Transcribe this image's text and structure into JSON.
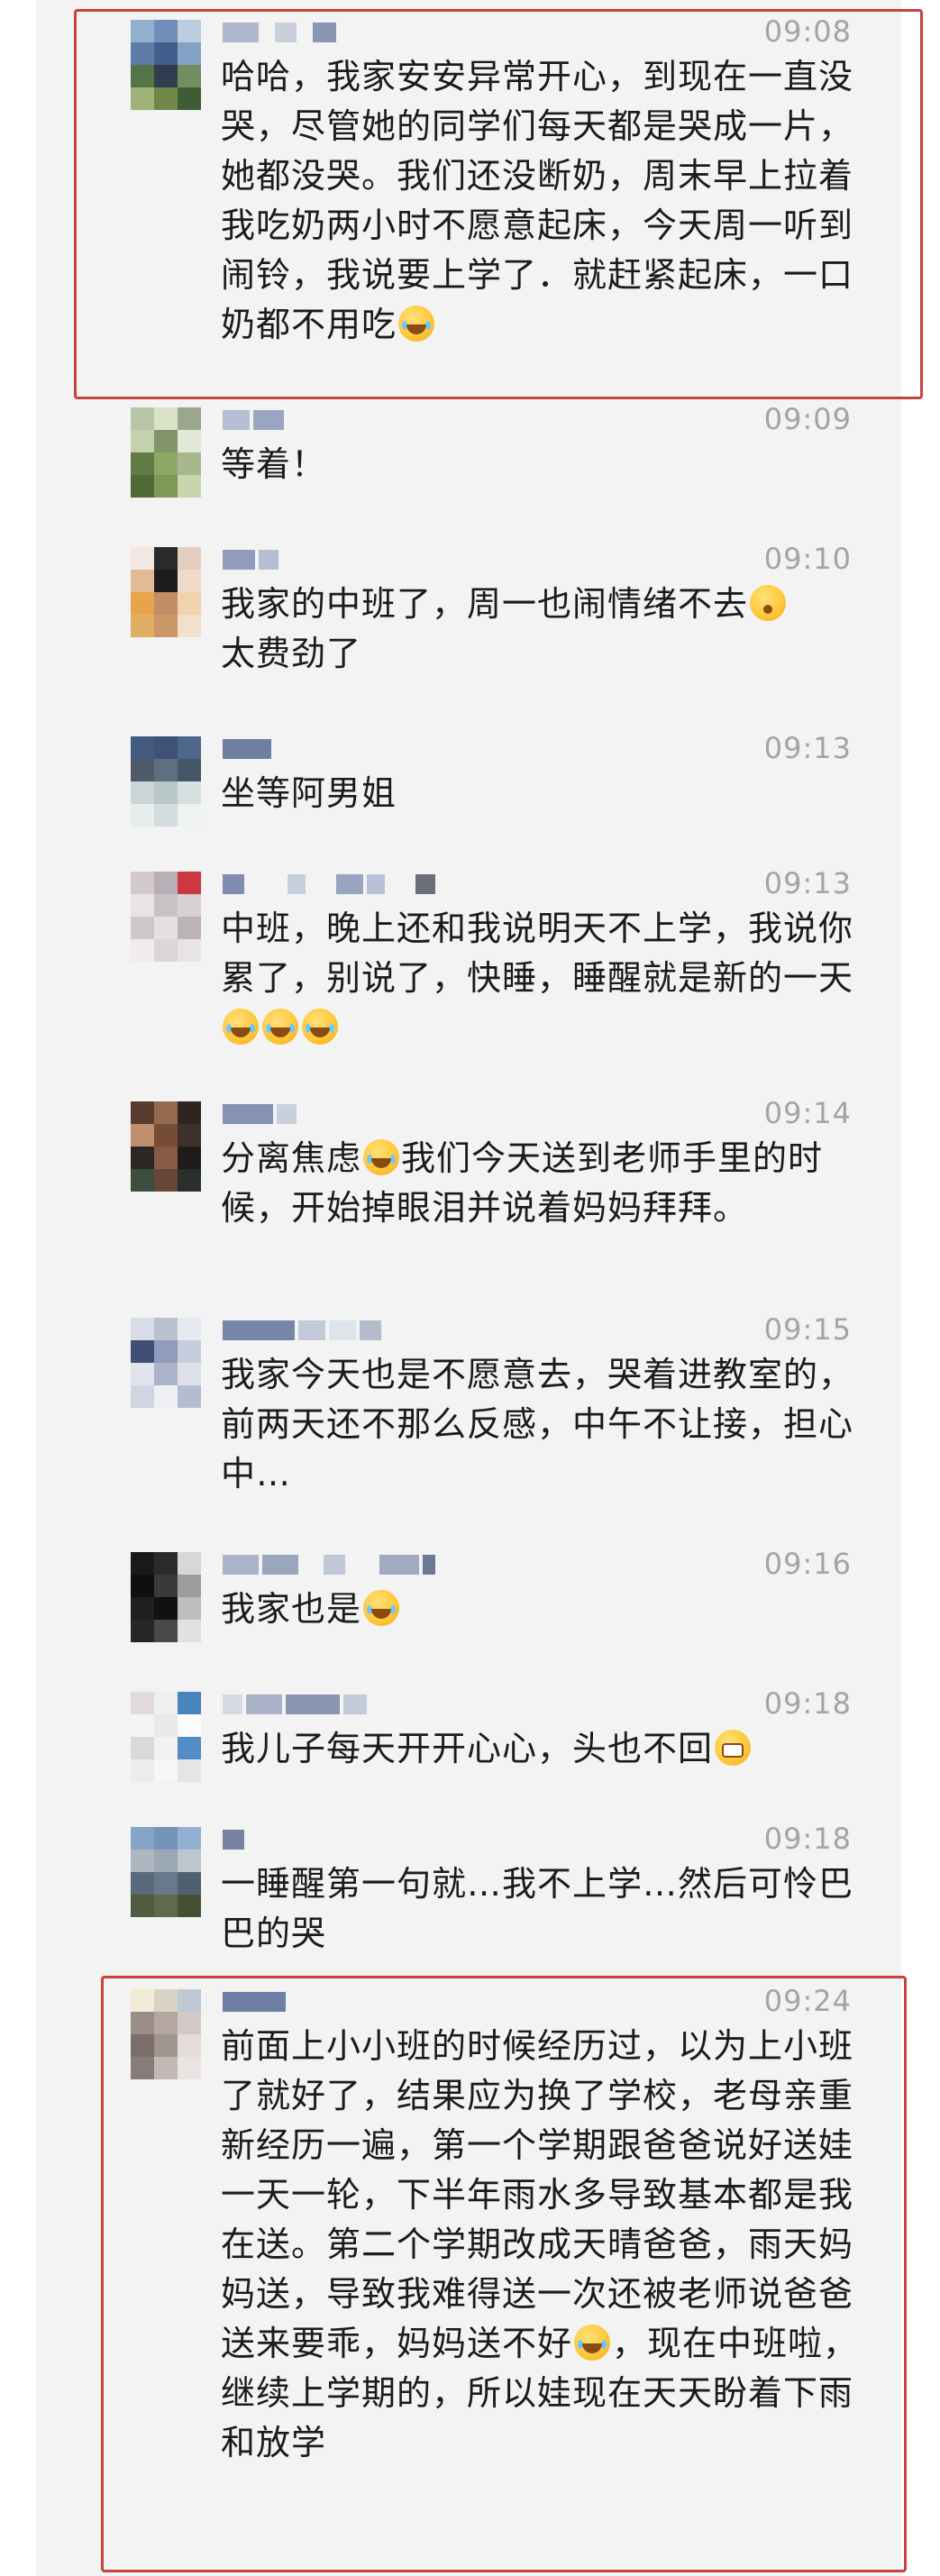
{
  "comments": [
    {
      "id": "c1",
      "time": "09:08",
      "text": "哈哈，我家安安异常开心，到现在一直没哭，尽管她的同学们每天都是哭成一片，她都没哭。我们还没断奶，周末早上拉着我吃奶两小时不愿意起床，今天周一听到闹铃，我说要上学了．就赶紧起床，一口奶都不用吃",
      "emoji": "laugh",
      "highlighted": true
    },
    {
      "id": "c2",
      "time": "09:09",
      "text": "等着！"
    },
    {
      "id": "c3",
      "time": "09:10",
      "text": "我家的中班了，周一也闹情绪不去",
      "emoji": "worried",
      "text_after": "太费劲了"
    },
    {
      "id": "c4",
      "time": "09:13",
      "text": "坐等阿男姐"
    },
    {
      "id": "c5",
      "time": "09:13",
      "text": "中班，晚上还和我说明天不上学，我说你累了，别说了，快睡，睡醒就是新的一天",
      "emoji": "laugh",
      "emoji_count": 3
    },
    {
      "id": "c6",
      "time": "09:14",
      "text": "分离焦虑",
      "emoji": "laugh",
      "text_after": "我们今天送到老师手里的时候，开始掉眼泪并说着妈妈拜拜。"
    },
    {
      "id": "c7",
      "time": "09:15",
      "text": "我家今天也是不愿意去，哭着进教室的，前两天还不那么反感，中午不让接，担心中…"
    },
    {
      "id": "c8",
      "time": "09:16",
      "text": "我家也是",
      "emoji": "laugh"
    },
    {
      "id": "c9",
      "time": "09:18",
      "text": "我儿子每天开开心心，头也不回",
      "emoji": "grin"
    },
    {
      "id": "c10",
      "time": "09:18",
      "text": "一睡醒第一句就…我不上学…然后可怜巴巴的哭"
    },
    {
      "id": "c11",
      "time": "09:24",
      "text": "前面上小小班的时候经历过，以为上小班了就好了，结果应为换了学校，老母亲重新经历一遍，第一个学期跟爸爸说好送娃一天一轮，下半年雨水多导致基本都是我在送。第二个学期改成天晴爸爸，雨天妈妈送，导致我难得送一次还被老师说爸爸送来要乖，妈妈送不好",
      "emoji": "laugh",
      "text_after": "，现在中班啦，继续上学期的，所以娃现在天天盼着下雨和放学",
      "highlighted": true
    }
  ],
  "colors": {
    "highlight_border": "#c9413f",
    "timestamp": "#a4a4a4",
    "text": "#1b1b1b",
    "feed_background": "#f3f3f3"
  }
}
